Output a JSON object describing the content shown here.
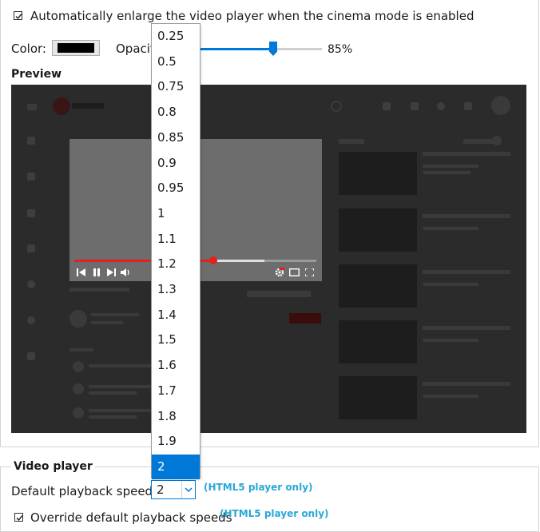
{
  "cinema": {
    "enlarge_label": "Automatically enlarge the video player when the cinema mode is enabled",
    "enlarge_checked": true,
    "color_label": "Color:",
    "color_value": "#000000",
    "opacity_label": "Opacity:",
    "opacity_value": 0.85,
    "opacity_text": "85%",
    "preview_label": "Preview"
  },
  "video_player": {
    "legend": "Video player",
    "speed_label": "Default playback speed:",
    "speed_value": "2",
    "speed_hint": "(HTML5 player only)",
    "override_label": "Override default playback speeds",
    "override_hint": "(HTML5 player only)",
    "override_checked": true
  },
  "speed_options": [
    "0.25",
    "0.5",
    "0.75",
    "0.8",
    "0.85",
    "0.9",
    "0.95",
    "1",
    "1.1",
    "1.2",
    "1.3",
    "1.4",
    "1.5",
    "1.6",
    "1.7",
    "1.8",
    "1.9",
    "2"
  ],
  "selected_option": "2",
  "colors": {
    "accent": "#0078d7",
    "hint": "#2aa7d6",
    "progress_red": "#e51e1e"
  }
}
